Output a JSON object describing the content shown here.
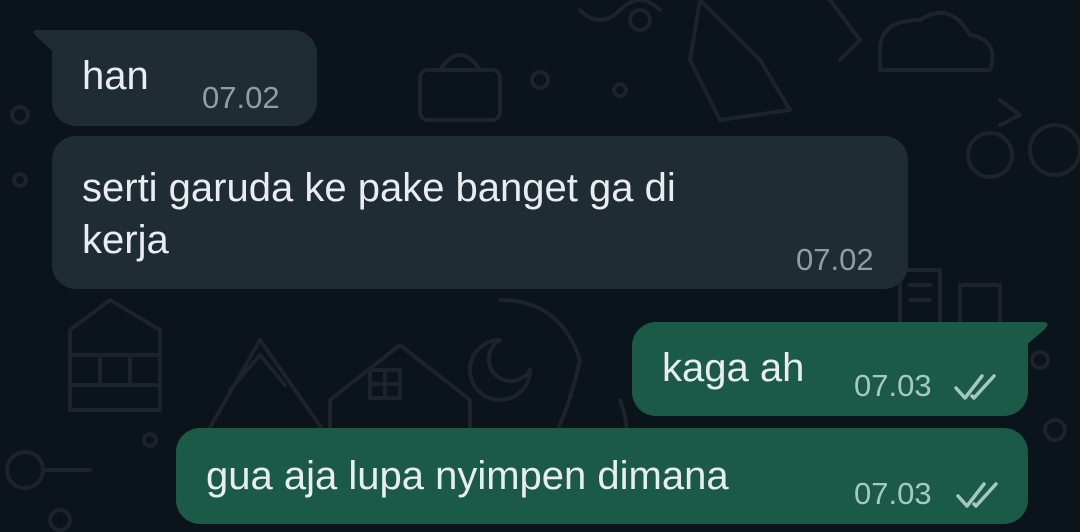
{
  "messages": [
    {
      "direction": "incoming",
      "text": "han",
      "time": "07.02"
    },
    {
      "direction": "incoming",
      "text_line1": "serti garuda ke pake banget ga di",
      "text_line2": "kerja",
      "time": "07.02"
    },
    {
      "direction": "outgoing",
      "text": "kaga ah",
      "time": "07.03",
      "status_icon": "double-check-read-icon"
    },
    {
      "direction": "outgoing",
      "text": "gua aja lupa nyimpen dimana",
      "time": "07.03",
      "status_icon": "double-check-read-icon"
    }
  ],
  "colors": {
    "background": "#0b141a",
    "incoming_bubble": "#1f2c34",
    "outgoing_bubble": "#1a5a46",
    "text": "#e9edef",
    "meta_incoming": "#8f9ea6",
    "meta_outgoing": "#a5c9bd"
  }
}
